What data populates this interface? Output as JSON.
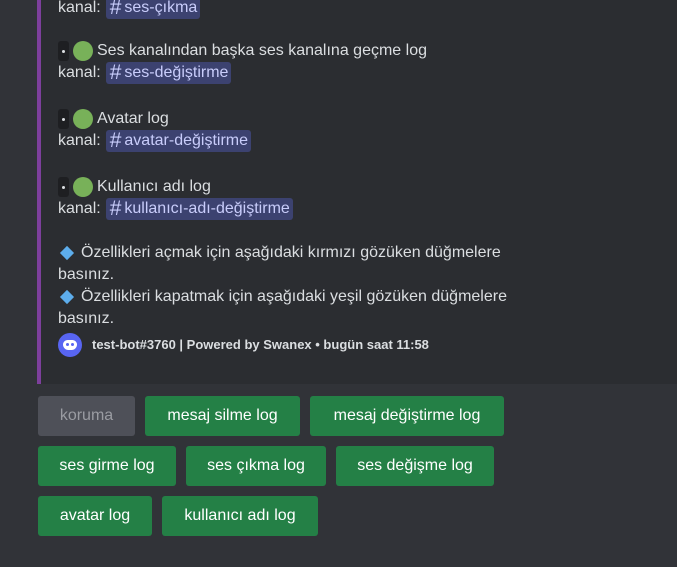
{
  "embed": {
    "accent_color": "#7d3f9c",
    "top_row": {
      "label": "kanal:",
      "channel": "ses-çıkma"
    },
    "items": [
      {
        "title": "Ses kanalından başka ses kanalına geçme log",
        "label": "kanal:",
        "channel": "ses-değiştirme"
      },
      {
        "title": "Avatar log",
        "label": "kanal:",
        "channel": "avatar-değiştirme"
      },
      {
        "title": "Kullanıcı adı log",
        "label": "kanal:",
        "channel": "kullanıcı-adı-değiştirme"
      }
    ],
    "notes": [
      {
        "line1": "Özellikleri açmak için aşağıdaki kırmızı gözüken düğmelere",
        "line2": "basınız."
      },
      {
        "line1": "Özellikleri kapatmak için aşağıdaki yeşil gözüken düğmelere",
        "line2": "basınız."
      }
    ],
    "footer": {
      "text": "test-bot#3760 | Powered by Swanex • bugün saat 11:58",
      "icon": "discord-icon"
    }
  },
  "buttons": [
    {
      "label": "koruma",
      "state": "disabled"
    },
    {
      "label": "mesaj silme log",
      "state": "green"
    },
    {
      "label": "mesaj değiştirme log",
      "state": "green"
    },
    {
      "label": "ses girme log",
      "state": "green"
    },
    {
      "label": "ses çıkma log",
      "state": "green"
    },
    {
      "label": "ses değişme log",
      "state": "green"
    },
    {
      "label": "avatar log",
      "state": "green"
    },
    {
      "label": "kullanıcı adı log",
      "state": "green"
    }
  ]
}
